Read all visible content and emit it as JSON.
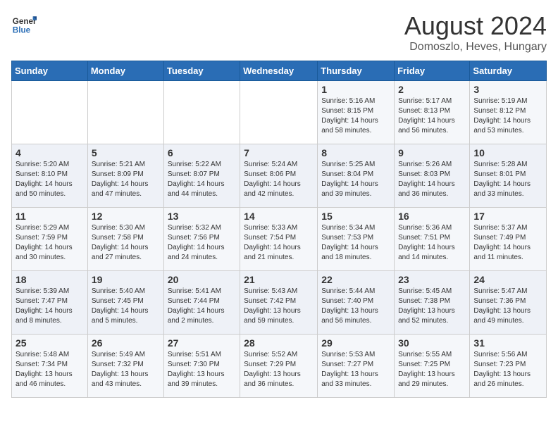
{
  "header": {
    "logo_general": "General",
    "logo_blue": "Blue",
    "month_year": "August 2024",
    "location": "Domoszlo, Heves, Hungary"
  },
  "weekdays": [
    "Sunday",
    "Monday",
    "Tuesday",
    "Wednesday",
    "Thursday",
    "Friday",
    "Saturday"
  ],
  "weeks": [
    [
      {
        "day": "",
        "info": ""
      },
      {
        "day": "",
        "info": ""
      },
      {
        "day": "",
        "info": ""
      },
      {
        "day": "",
        "info": ""
      },
      {
        "day": "1",
        "info": "Sunrise: 5:16 AM\nSunset: 8:15 PM\nDaylight: 14 hours\nand 58 minutes."
      },
      {
        "day": "2",
        "info": "Sunrise: 5:17 AM\nSunset: 8:13 PM\nDaylight: 14 hours\nand 56 minutes."
      },
      {
        "day": "3",
        "info": "Sunrise: 5:19 AM\nSunset: 8:12 PM\nDaylight: 14 hours\nand 53 minutes."
      }
    ],
    [
      {
        "day": "4",
        "info": "Sunrise: 5:20 AM\nSunset: 8:10 PM\nDaylight: 14 hours\nand 50 minutes."
      },
      {
        "day": "5",
        "info": "Sunrise: 5:21 AM\nSunset: 8:09 PM\nDaylight: 14 hours\nand 47 minutes."
      },
      {
        "day": "6",
        "info": "Sunrise: 5:22 AM\nSunset: 8:07 PM\nDaylight: 14 hours\nand 44 minutes."
      },
      {
        "day": "7",
        "info": "Sunrise: 5:24 AM\nSunset: 8:06 PM\nDaylight: 14 hours\nand 42 minutes."
      },
      {
        "day": "8",
        "info": "Sunrise: 5:25 AM\nSunset: 8:04 PM\nDaylight: 14 hours\nand 39 minutes."
      },
      {
        "day": "9",
        "info": "Sunrise: 5:26 AM\nSunset: 8:03 PM\nDaylight: 14 hours\nand 36 minutes."
      },
      {
        "day": "10",
        "info": "Sunrise: 5:28 AM\nSunset: 8:01 PM\nDaylight: 14 hours\nand 33 minutes."
      }
    ],
    [
      {
        "day": "11",
        "info": "Sunrise: 5:29 AM\nSunset: 7:59 PM\nDaylight: 14 hours\nand 30 minutes."
      },
      {
        "day": "12",
        "info": "Sunrise: 5:30 AM\nSunset: 7:58 PM\nDaylight: 14 hours\nand 27 minutes."
      },
      {
        "day": "13",
        "info": "Sunrise: 5:32 AM\nSunset: 7:56 PM\nDaylight: 14 hours\nand 24 minutes."
      },
      {
        "day": "14",
        "info": "Sunrise: 5:33 AM\nSunset: 7:54 PM\nDaylight: 14 hours\nand 21 minutes."
      },
      {
        "day": "15",
        "info": "Sunrise: 5:34 AM\nSunset: 7:53 PM\nDaylight: 14 hours\nand 18 minutes."
      },
      {
        "day": "16",
        "info": "Sunrise: 5:36 AM\nSunset: 7:51 PM\nDaylight: 14 hours\nand 14 minutes."
      },
      {
        "day": "17",
        "info": "Sunrise: 5:37 AM\nSunset: 7:49 PM\nDaylight: 14 hours\nand 11 minutes."
      }
    ],
    [
      {
        "day": "18",
        "info": "Sunrise: 5:39 AM\nSunset: 7:47 PM\nDaylight: 14 hours\nand 8 minutes."
      },
      {
        "day": "19",
        "info": "Sunrise: 5:40 AM\nSunset: 7:45 PM\nDaylight: 14 hours\nand 5 minutes."
      },
      {
        "day": "20",
        "info": "Sunrise: 5:41 AM\nSunset: 7:44 PM\nDaylight: 14 hours\nand 2 minutes."
      },
      {
        "day": "21",
        "info": "Sunrise: 5:43 AM\nSunset: 7:42 PM\nDaylight: 13 hours\nand 59 minutes."
      },
      {
        "day": "22",
        "info": "Sunrise: 5:44 AM\nSunset: 7:40 PM\nDaylight: 13 hours\nand 56 minutes."
      },
      {
        "day": "23",
        "info": "Sunrise: 5:45 AM\nSunset: 7:38 PM\nDaylight: 13 hours\nand 52 minutes."
      },
      {
        "day": "24",
        "info": "Sunrise: 5:47 AM\nSunset: 7:36 PM\nDaylight: 13 hours\nand 49 minutes."
      }
    ],
    [
      {
        "day": "25",
        "info": "Sunrise: 5:48 AM\nSunset: 7:34 PM\nDaylight: 13 hours\nand 46 minutes."
      },
      {
        "day": "26",
        "info": "Sunrise: 5:49 AM\nSunset: 7:32 PM\nDaylight: 13 hours\nand 43 minutes."
      },
      {
        "day": "27",
        "info": "Sunrise: 5:51 AM\nSunset: 7:30 PM\nDaylight: 13 hours\nand 39 minutes."
      },
      {
        "day": "28",
        "info": "Sunrise: 5:52 AM\nSunset: 7:29 PM\nDaylight: 13 hours\nand 36 minutes."
      },
      {
        "day": "29",
        "info": "Sunrise: 5:53 AM\nSunset: 7:27 PM\nDaylight: 13 hours\nand 33 minutes."
      },
      {
        "day": "30",
        "info": "Sunrise: 5:55 AM\nSunset: 7:25 PM\nDaylight: 13 hours\nand 29 minutes."
      },
      {
        "day": "31",
        "info": "Sunrise: 5:56 AM\nSunset: 7:23 PM\nDaylight: 13 hours\nand 26 minutes."
      }
    ]
  ]
}
